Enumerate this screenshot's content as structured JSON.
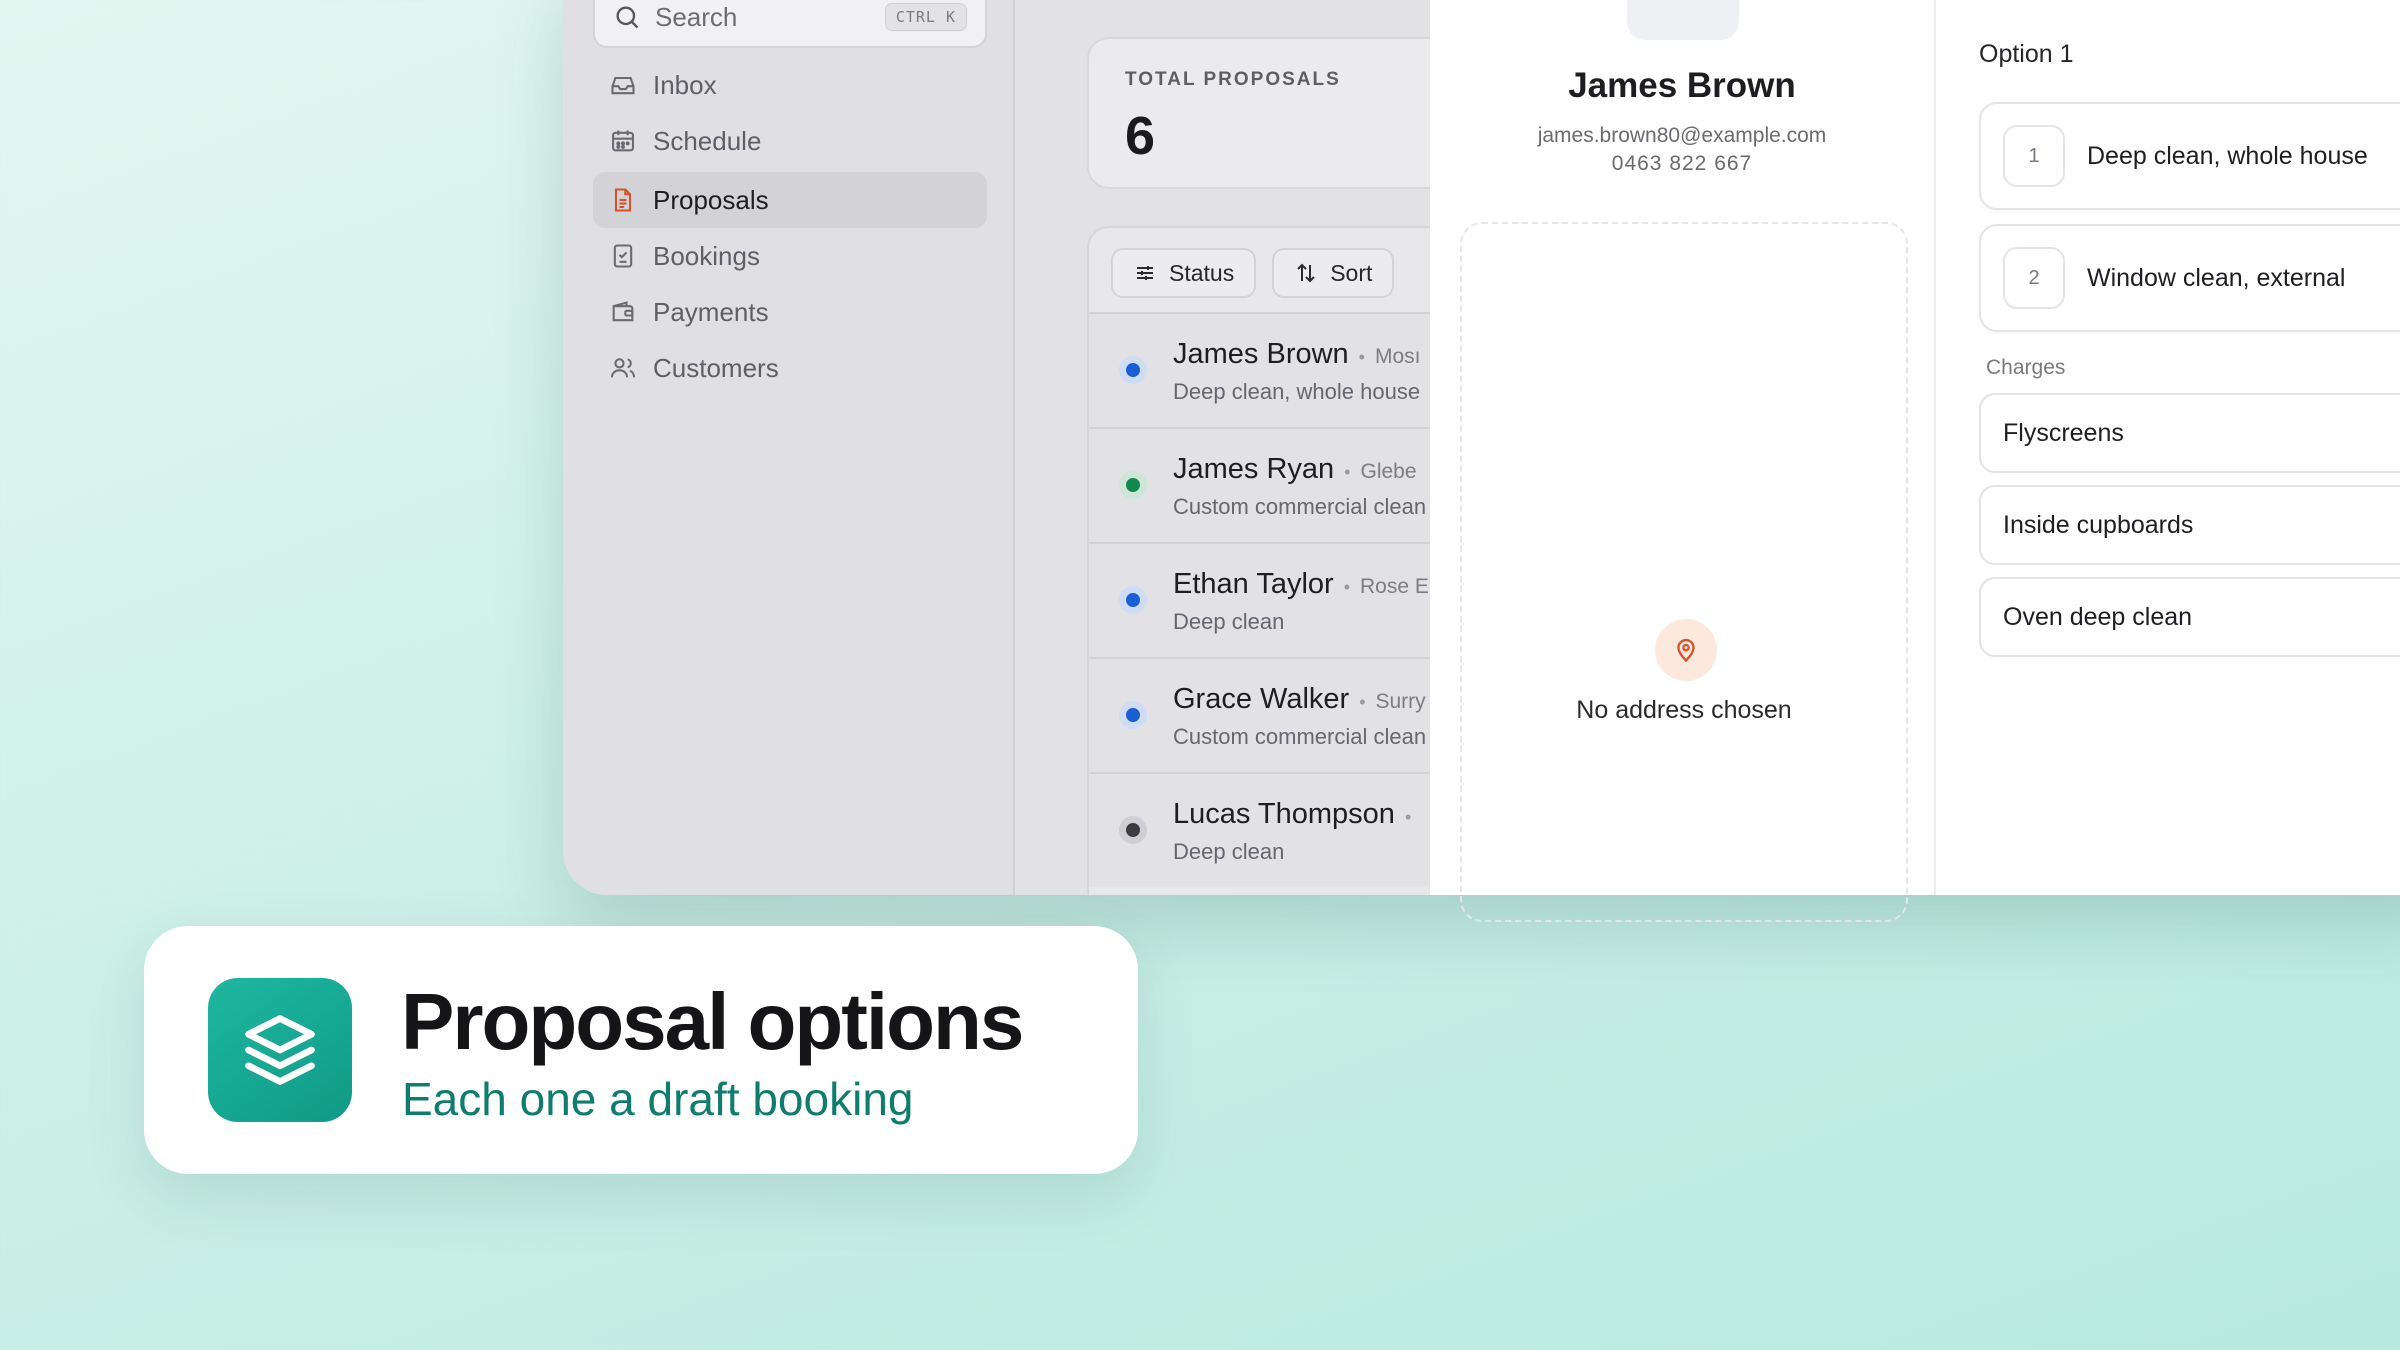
{
  "sidebar": {
    "search_placeholder": "Search",
    "search_shortcut": "CTRL K",
    "items": [
      {
        "label": "Inbox",
        "icon": "inbox-icon"
      },
      {
        "label": "Schedule",
        "icon": "calendar-icon"
      },
      {
        "label": "Proposals",
        "icon": "document-icon",
        "active": true
      },
      {
        "label": "Bookings",
        "icon": "checklist-icon"
      },
      {
        "label": "Payments",
        "icon": "wallet-icon"
      },
      {
        "label": "Customers",
        "icon": "users-icon"
      }
    ]
  },
  "stats": {
    "total_label": "TOTAL PROPOSALS",
    "total_value": "6"
  },
  "filters": {
    "status_label": "Status",
    "sort_label": "Sort"
  },
  "proposals": [
    {
      "name": "James Brown",
      "suburb": "Mosı",
      "service": "Deep clean, whole house",
      "status_color": "#1b5fd6"
    },
    {
      "name": "James Ryan",
      "suburb": "Glebe",
      "service": "Custom commercial clean",
      "status_color": "#12874f"
    },
    {
      "name": "Ethan Taylor",
      "suburb": "Rose E",
      "service": "Deep clean",
      "status_color": "#1b5fd6"
    },
    {
      "name": "Grace Walker",
      "suburb": "Surry",
      "service": "Custom commercial clean",
      "status_color": "#1b5fd6"
    },
    {
      "name": "Lucas Thompson",
      "suburb": "",
      "service": "Deep clean",
      "status_color": "#3b3b42"
    }
  ],
  "customer": {
    "name": "James Brown",
    "email": "james.brown80@example.com",
    "phone": "0463 822 667",
    "address_empty": "No address chosen"
  },
  "option": {
    "title": "Option 1",
    "items": [
      {
        "num": "1",
        "label": "Deep clean, whole house"
      },
      {
        "num": "2",
        "label": "Window clean, external"
      }
    ],
    "charges_title": "Charges",
    "charges": [
      "Flyscreens",
      "Inside cupboards",
      "Oven deep clean"
    ]
  },
  "callout": {
    "title": "Proposal options",
    "subtitle": "Each one a draft booking"
  },
  "colors": {
    "accent": "#0f9a86",
    "active_nav_icon": "#d4532a",
    "pin": "#d4532a"
  }
}
